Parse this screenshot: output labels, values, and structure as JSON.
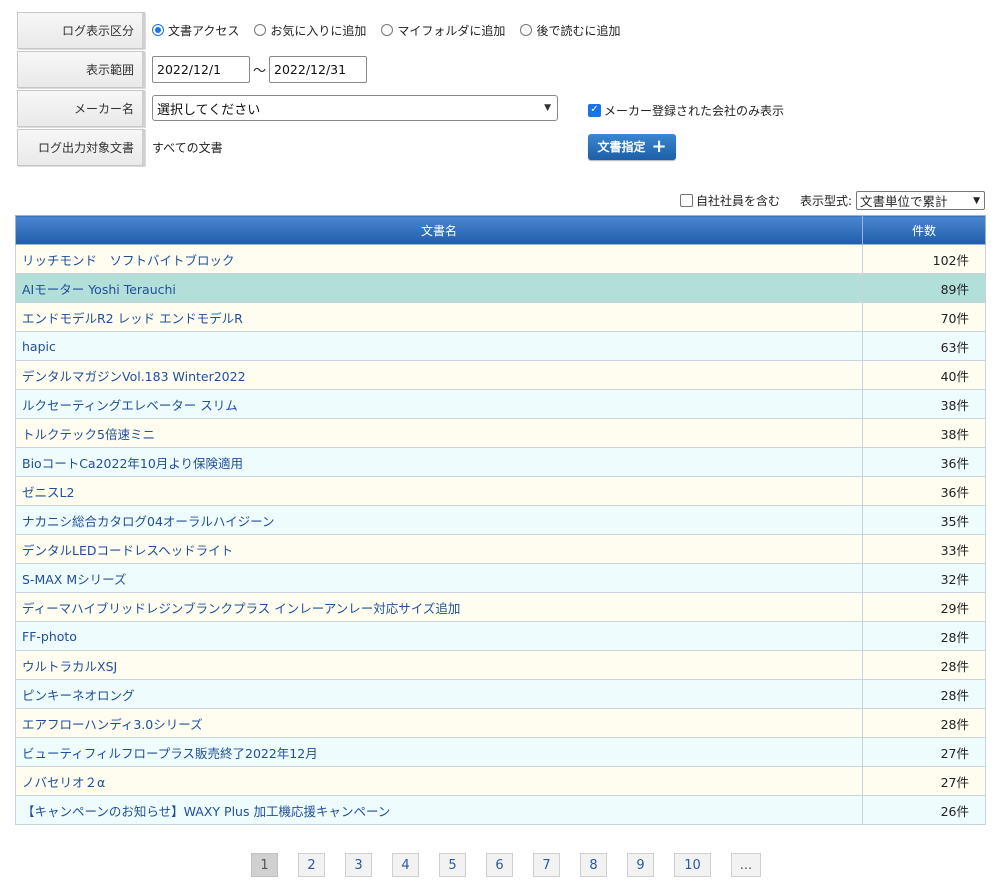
{
  "filters": {
    "log_type": {
      "label": "ログ表示区分",
      "options": [
        "文書アクセス",
        "お気に入りに追加",
        "マイフォルダに追加",
        "後で読むに追加"
      ],
      "selected_index": 0
    },
    "range": {
      "label": "表示範囲",
      "from": "2022/12/1",
      "to": "2022/12/31",
      "separator": "〜"
    },
    "maker": {
      "label": "メーカー名",
      "selected": "選択してください",
      "checkbox_label": "メーカー登録された会社のみ表示",
      "checkbox_checked": true
    },
    "target_docs": {
      "label": "ログ出力対象文書",
      "value": "すべての文書",
      "button_label": "文書指定"
    }
  },
  "options_bar": {
    "include_staff_label": "自社社員を含む",
    "include_staff_checked": false,
    "display_format_label": "表示型式:",
    "display_format_value": "文書単位で累計"
  },
  "table": {
    "headers": {
      "name": "文書名",
      "count": "件数"
    },
    "highlight_index": 1,
    "rows": [
      {
        "name": "リッチモンド　ソフトバイトブロック",
        "count": "102件"
      },
      {
        "name": "AIモーター Yoshi Terauchi",
        "count": "89件"
      },
      {
        "name": "エンドモデルR2 レッド エンドモデルR",
        "count": "70件"
      },
      {
        "name": "hapic",
        "count": "63件"
      },
      {
        "name": "デンタルマガジンVol.183 Winter2022",
        "count": "40件"
      },
      {
        "name": "ルクセーティングエレベーター スリム",
        "count": "38件"
      },
      {
        "name": "トルクテック5倍速ミニ",
        "count": "38件"
      },
      {
        "name": "BioコートCa2022年10月より保険適用",
        "count": "36件"
      },
      {
        "name": "ゼニスL2",
        "count": "36件"
      },
      {
        "name": "ナカニシ総合カタログ04オーラルハイジーン",
        "count": "35件"
      },
      {
        "name": "デンタルLEDコードレスヘッドライト",
        "count": "33件"
      },
      {
        "name": "S-MAX Mシリーズ",
        "count": "32件"
      },
      {
        "name": "ディーマハイブリッドレジンブランクプラス インレーアンレー対応サイズ追加",
        "count": "29件"
      },
      {
        "name": "FF-photo",
        "count": "28件"
      },
      {
        "name": "ウルトラカルXSJ",
        "count": "28件"
      },
      {
        "name": "ピンキーネオロング",
        "count": "28件"
      },
      {
        "name": "エアフローハンディ3.0シリーズ",
        "count": "28件"
      },
      {
        "name": "ビューティフィルフロープラス販売終了2022年12月",
        "count": "27件"
      },
      {
        "name": "ノバセリオ２α",
        "count": "27件"
      },
      {
        "name": "【キャンペーンのお知らせ】WAXY Plus 加工機応援キャンペーン",
        "count": "26件"
      }
    ]
  },
  "pagination": {
    "pages": [
      "1",
      "2",
      "3",
      "4",
      "5",
      "6",
      "7",
      "8",
      "9",
      "10"
    ],
    "current": "1",
    "more": "..."
  }
}
